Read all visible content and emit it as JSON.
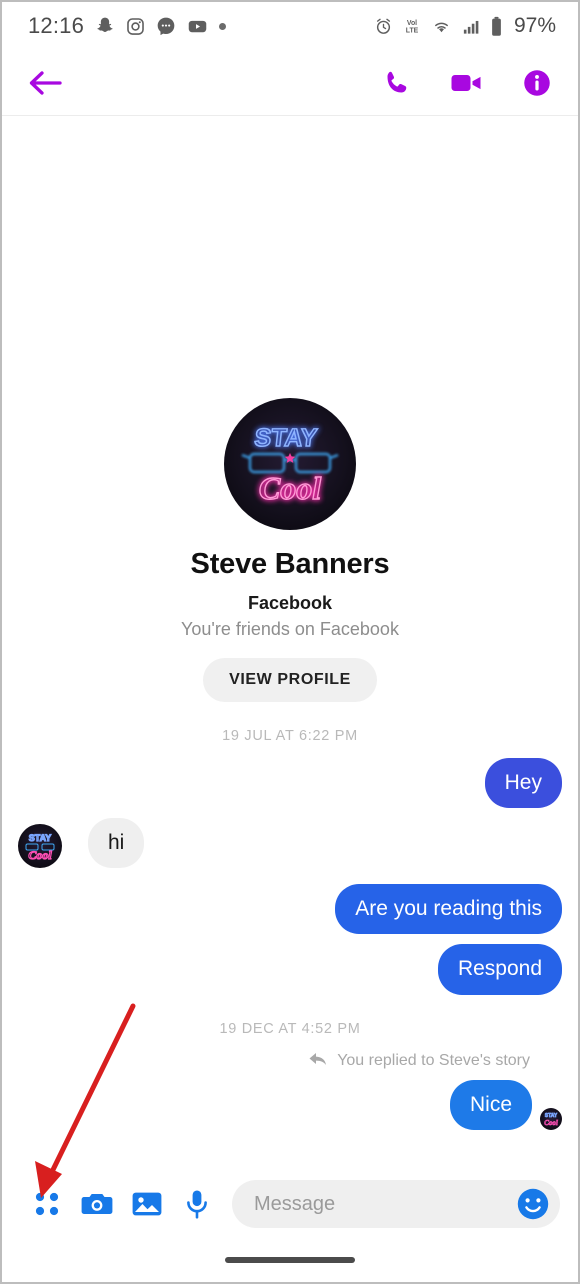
{
  "status_bar": {
    "clock": "12:16",
    "battery_percent": "97%",
    "left_icons": [
      "snapchat-icon",
      "instagram-icon",
      "messenger-icon",
      "youtube-icon",
      "notification-dot-icon"
    ],
    "right_icons": [
      "alarm-icon",
      "volte-icon",
      "wifi-icon",
      "signal-icon",
      "battery-icon"
    ],
    "volte_label_top": "Vol",
    "volte_label_bottom": "LTE"
  },
  "header": {
    "back_label": "Back",
    "accent_color": "#a808e0",
    "actions": [
      "audio-call-button",
      "video-call-button",
      "conversation-info-button"
    ]
  },
  "profile": {
    "name": "Steve Banners",
    "source": "Facebook",
    "relation": "You're friends on Facebook",
    "view_profile_label": "VIEW PROFILE",
    "avatar_alt": "STAY Cool neon sign avatar",
    "avatar_text_top": "STAY",
    "avatar_text_bottom": "Cool"
  },
  "conversation": {
    "sections": [
      {
        "timestamp": "19 JUL AT 6:22 PM",
        "messages": [
          {
            "text": "Hey",
            "direction": "out",
            "color": "#3b4fdd"
          },
          {
            "text": "hi",
            "direction": "in",
            "color": "#efefef"
          },
          {
            "text": "Are you reading this",
            "direction": "out",
            "color": "#2663e8"
          },
          {
            "text": "Respond",
            "direction": "out",
            "color": "#2663e8"
          }
        ]
      },
      {
        "timestamp": "19 DEC AT 4:52 PM",
        "reply_note": "You replied to Steve's story",
        "messages": [
          {
            "text": "Nice",
            "direction": "out",
            "color": "#1e7ae8"
          }
        ]
      }
    ]
  },
  "composer": {
    "placeholder": "Message",
    "value": "",
    "accent_color": "#1779e8",
    "icons": [
      "apps-grid-icon",
      "camera-icon",
      "gallery-icon",
      "microphone-icon",
      "emoji-icon"
    ]
  },
  "annotation": {
    "arrow_color": "#d81f1f",
    "points_to": "apps-grid-icon"
  },
  "gesture_bar": {
    "label": "home-indicator"
  }
}
